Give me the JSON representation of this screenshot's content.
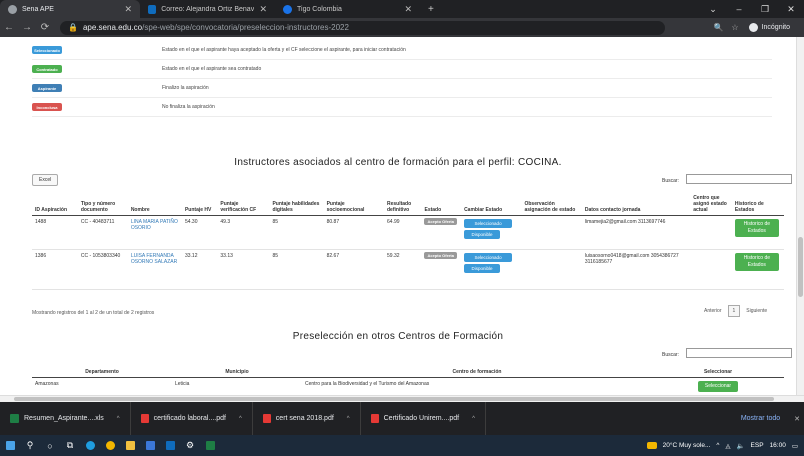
{
  "browser": {
    "tabs": [
      {
        "title": "Sena APE",
        "active": true
      },
      {
        "title": "Correo: Alejandra Ortiz Benavide",
        "active": false
      },
      {
        "title": "Tigo Colombia",
        "active": false
      }
    ],
    "new_tab": "+",
    "url_domain": "ape.sena.edu.co",
    "url_path": "/spe-web/spe/convocatoria/preseleccion-instructores-2022",
    "incognito_label": "Incógnito"
  },
  "legend": [
    {
      "badge": "Seleccionado",
      "desc": "Estado en el que el aspirante haya aceptado la oferta y el CF seleccione el aspirante, para iniciar contratación",
      "color": "#3a9ad9"
    },
    {
      "badge": "Contratado",
      "desc": "Estado en el que el aspirante sea contratado",
      "color": "#4cb050"
    },
    {
      "badge": "Aspirante",
      "desc": "Finalizo la aspiración",
      "color": "#3f7fb5"
    },
    {
      "badge": "Inconclusa",
      "desc": "No finaliza la aspiración",
      "color": "#d9534f"
    }
  ],
  "section1": {
    "title": "Instructores asociados al centro de formación para el perfil: COCINA.",
    "excel": "Excel",
    "search_label": "Buscar:",
    "headers": [
      "ID Aspiración",
      "Tipo y número documento",
      "Nombre",
      "Puntaje HV",
      "Puntaje verificación CF",
      "Puntaje habilidades digitales",
      "Puntaje socioemocional",
      "Resultado definitivo",
      "Estado",
      "Cambiar Estado",
      "Observación asignación de estado",
      "Datos contacto jornada",
      "Centro que asignó estado actual",
      "Historico de Estados"
    ],
    "rows": [
      {
        "id": "1488",
        "doc": "CC - 40483711",
        "name": "LINA MARIA PATIÑO OSORIO",
        "hv": "54.30",
        "verif": "49.3",
        "digital": "85",
        "socio": "80.87",
        "result": "64.99",
        "state": "Acepto Oferta",
        "btn1": "Seleccionado",
        "btn2": "Disponible",
        "obs": "",
        "contact": "limamejia2@gmail.com 3113697746",
        "centro": "",
        "hist": "Historico de Estados"
      },
      {
        "id": "1386",
        "doc": "CC - 1053803340",
        "name": "LUISA FERNANDA OSORNO SALAZAR",
        "hv": "33.12",
        "verif": "33.13",
        "digital": "85",
        "socio": "82.67",
        "result": "59.32",
        "state": "Acepto Oferta",
        "btn1": "Seleccionado",
        "btn2": "Disponible",
        "obs": "",
        "contact": "luisaosorno0418@gmail.com 3054386727 3116185677",
        "centro": "",
        "hist": "Historico de Estados"
      }
    ],
    "info": "Mostrando registros del 1 al 2 de un total de 2 registros",
    "prev": "Anterior",
    "page": "1",
    "next": "Siguiente"
  },
  "section2": {
    "title": "Preselección en otros Centros de Formación",
    "search_label": "Buscar:",
    "headers": [
      "Departamento",
      "Municipio",
      "Centro de formación",
      "Seleccionar"
    ],
    "rows": [
      {
        "dep": "Amazonas",
        "mun": "Leticia",
        "centro": "Centro para la Biodiversidad y el Turismo del Amazonas",
        "btn": "Seleccionar"
      }
    ]
  },
  "downloads": {
    "items": [
      "Resumen_Aspirante....xls",
      "certificado laboral....pdf",
      "cert sena 2018.pdf",
      "Certificado Unirem....pdf"
    ],
    "show_all": "Mostrar todo"
  },
  "taskbar": {
    "weather": "20°C Muy sole...",
    "lang": "ESP",
    "time": "16:00"
  }
}
